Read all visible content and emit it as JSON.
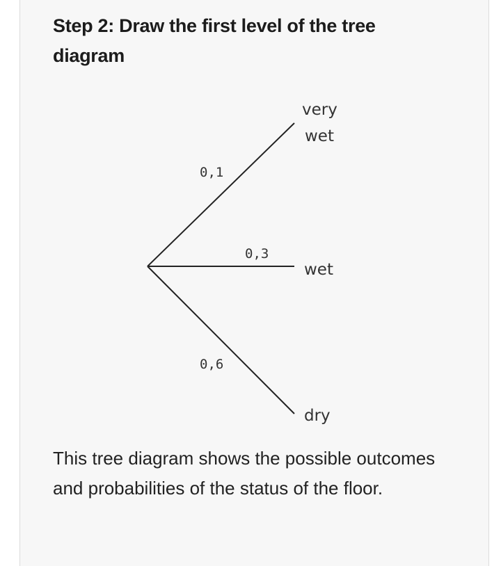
{
  "step": {
    "title": "Step 2: Draw the first level of the tree diagram"
  },
  "tree": {
    "branches": [
      {
        "probability": "0,1",
        "outcome_line1": "very",
        "outcome_line2": "wet"
      },
      {
        "probability": "0,3",
        "outcome": "wet"
      },
      {
        "probability": "0,6",
        "outcome": "dry"
      }
    ]
  },
  "description": "This tree diagram shows the possible outcomes and probabilities of the status of the floor."
}
